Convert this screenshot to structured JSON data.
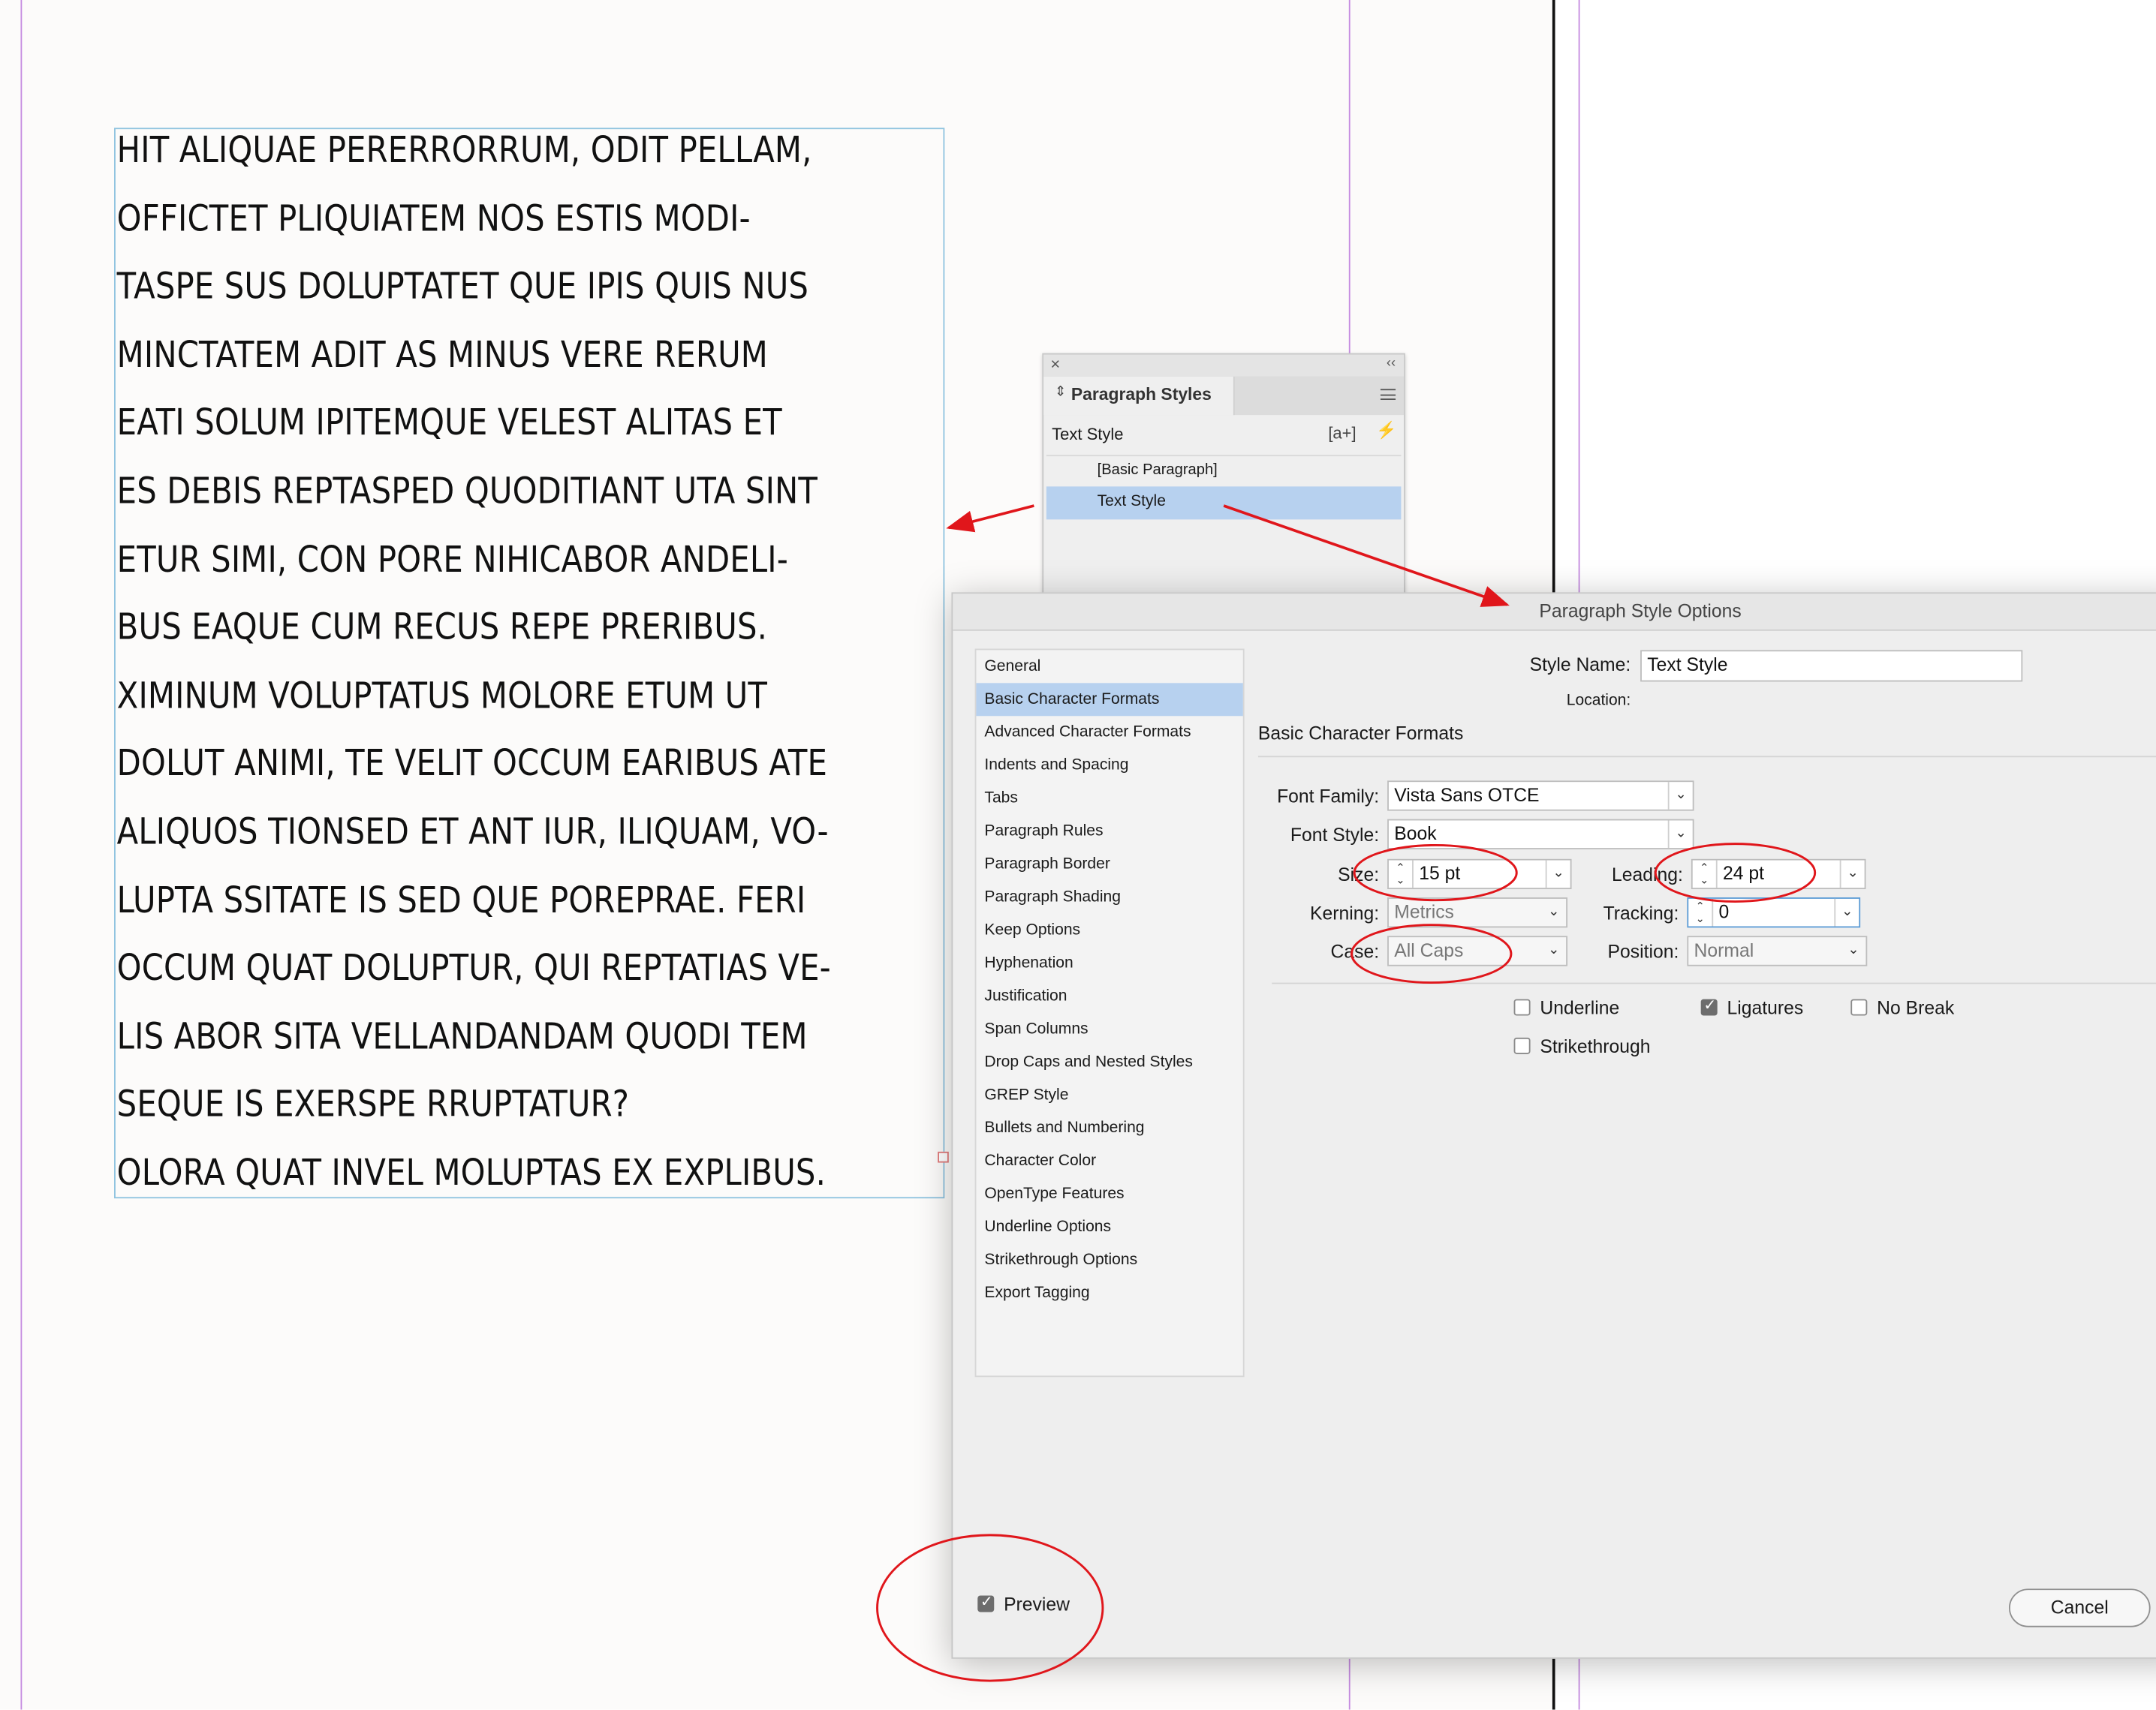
{
  "document": {
    "body_lines": [
      "HIT ALIQUAE PERERRORRUM, ODIT PELLAM,",
      "OFFICTET PLIQUIATEM NOS ESTIS MODI-",
      "TASPE SUS DOLUPTATET QUE IPIS QUIS NUS",
      "MINCTATEM ADIT AS MINUS VERE RERUM",
      "EATI SOLUM IPITEMQUE VELEST ALITAS ET",
      "ES DEBIS REPTASPED QUODITIANT UTA SINT",
      "ETUR SIMI, CON PORE NIHICABOR ANDELI-",
      "BUS EAQUE CUM RECUS REPE PRERIBUS.",
      "XIMINUM VOLUPTATUS MOLORE ETUM UT",
      "DOLUT ANIMI, TE VELIT OCCUM EARIBUS ATE",
      "ALIQUOS TIONSED ET ANT IUR, ILIQUAM, VO-",
      "LUPTA SSITATE IS SED QUE POREPRAE. FERI",
      "OCCUM QUAT DOLUPTUR, QUI REPTATIAS VE-",
      "LIS ABOR SITA VELLANDANDAM QUODI TEM",
      "SEQUE IS EXERSPE RRUPTATUR?",
      "OLORA QUAT INVEL MOLUPTAS EX EXPLIBUS."
    ]
  },
  "paragraph_styles_panel": {
    "close_glyph": "×",
    "collapse_glyph": "‹‹",
    "tab_icon": "⇕",
    "tab_label": "Paragraph Styles",
    "menu_icon": "hamburger-menu-icon",
    "current_style": "Text Style",
    "new_style_glyph": "[a+]",
    "quick_apply_glyph": "⚡",
    "styles": [
      "[Basic Paragraph]",
      "Text Style"
    ],
    "selected_style": "Text Style"
  },
  "dialog": {
    "title": "Paragraph Style Options",
    "style_name_label": "Style Name:",
    "style_name_value": "Text Style",
    "location_label": "Location:",
    "section_title": "Basic Character Formats",
    "sidebar_items": [
      "General",
      "Basic Character Formats",
      "Advanced Character Formats",
      "Indents and Spacing",
      "Tabs",
      "Paragraph Rules",
      "Paragraph Border",
      "Paragraph Shading",
      "Keep Options",
      "Hyphenation",
      "Justification",
      "Span Columns",
      "Drop Caps and Nested Styles",
      "GREP Style",
      "Bullets and Numbering",
      "Character Color",
      "OpenType Features",
      "Underline Options",
      "Strikethrough Options",
      "Export Tagging"
    ],
    "selected_item": "Basic Character Formats",
    "fields": {
      "font_family": {
        "label": "Font Family:",
        "value": "Vista Sans OTCE"
      },
      "font_style": {
        "label": "Font Style:",
        "value": "Book"
      },
      "size": {
        "label": "Size:",
        "value": "15 pt"
      },
      "leading": {
        "label": "Leading:",
        "value": "24 pt"
      },
      "kerning": {
        "label": "Kerning:",
        "value": "Metrics"
      },
      "tracking": {
        "label": "Tracking:",
        "value": "0"
      },
      "case": {
        "label": "Case:",
        "value": "All Caps"
      },
      "position": {
        "label": "Position:",
        "value": "Normal"
      }
    },
    "checkboxes": {
      "underline": {
        "label": "Underline",
        "checked": false
      },
      "ligatures": {
        "label": "Ligatures",
        "checked": true
      },
      "no_break": {
        "label": "No Break",
        "checked": false
      },
      "strikethrough": {
        "label": "Strikethrough",
        "checked": false
      }
    },
    "preview": {
      "label": "Preview",
      "checked": true
    },
    "cancel_label": "Cancel"
  },
  "annotations": {
    "color": "#e0161b",
    "chevron_glyph": "⌄",
    "spin_glyph_up": "⌃",
    "spin_glyph_down": "⌄"
  },
  "colors": {
    "page": "#fcfbfa",
    "guide_magenta": "#c58be0",
    "frame_cyan": "#8fc3df",
    "selection_blue": "#b7d1ef"
  }
}
